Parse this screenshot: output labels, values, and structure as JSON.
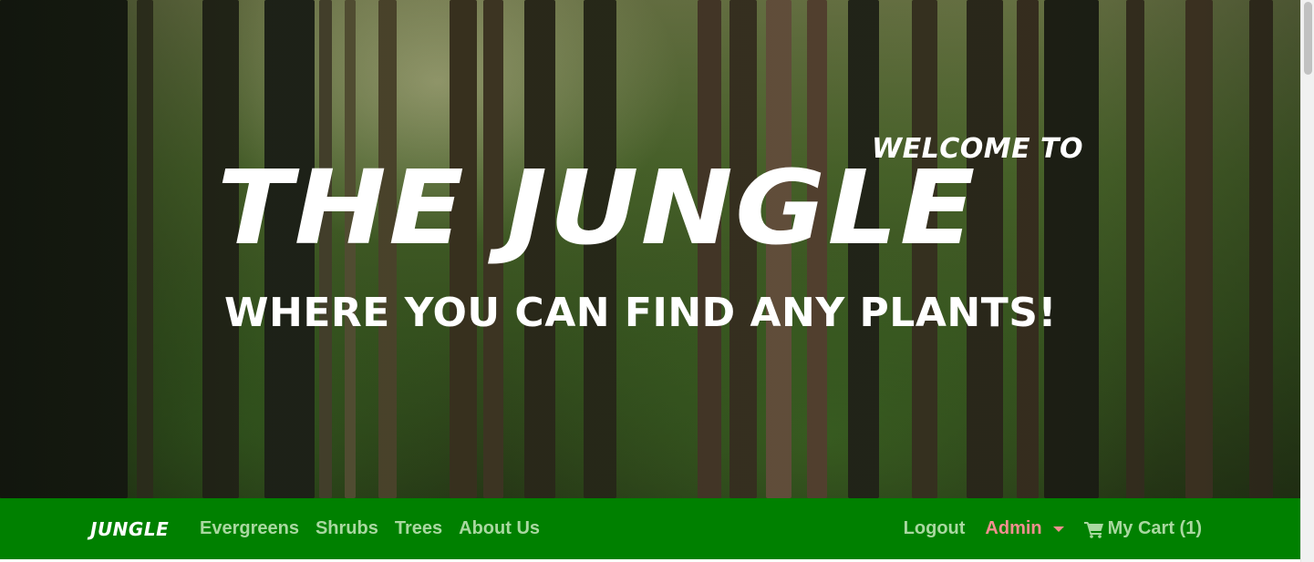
{
  "hero": {
    "welcome": "WELCOME TO",
    "title": "THE JUNGLE",
    "subtitle": "WHERE YOU CAN FIND ANY PLANTS!"
  },
  "navbar": {
    "brand": "JUNGLE",
    "links": [
      "Evergreens",
      "Shrubs",
      "Trees",
      "About Us"
    ],
    "logout": "Logout",
    "admin": "Admin",
    "cart": "My Cart (1)",
    "color": "#008000"
  },
  "icons": {
    "admin_dropdown": "chevron-down-icon",
    "cart": "shopping-cart-icon"
  }
}
